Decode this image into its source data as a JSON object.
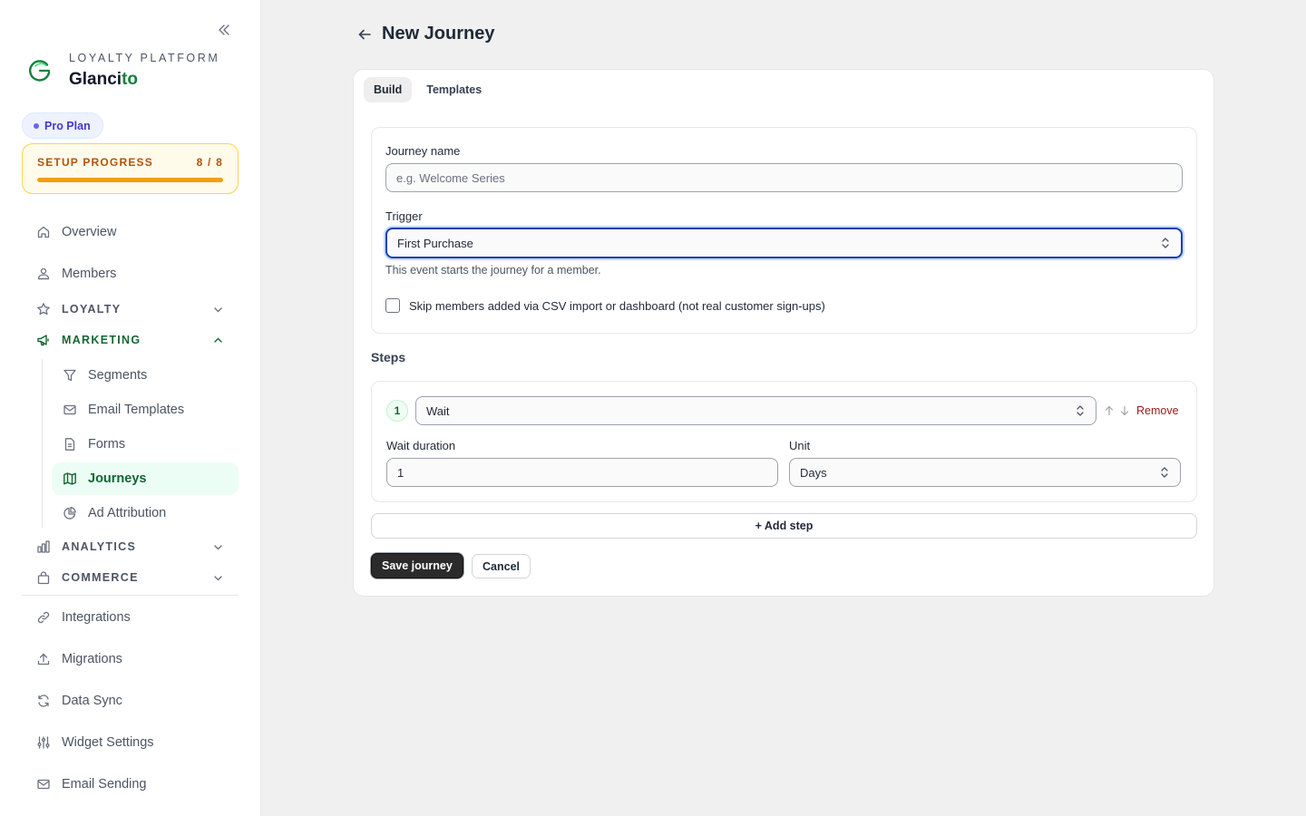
{
  "brand": {
    "eyebrow": "LOYALTY PLATFORM",
    "name_main": "Glanci",
    "name_accent": "to",
    "accent_color": "#15803d"
  },
  "plan_badge": "Pro Plan",
  "setup": {
    "label": "SETUP PROGRESS",
    "count": "8 / 8",
    "progress_fraction": 1.0
  },
  "nav": {
    "overview": "Overview",
    "members": "Members",
    "loyalty": "LOYALTY",
    "marketing": "MARKETING",
    "marketing_items": {
      "segments": "Segments",
      "email_templates": "Email Templates",
      "forms": "Forms",
      "journeys": "Journeys",
      "ad_attribution": "Ad Attribution"
    },
    "analytics": "ANALYTICS",
    "commerce": "COMMERCE",
    "integrations": "Integrations",
    "migrations": "Migrations",
    "data_sync": "Data Sync",
    "widget_settings": "Widget Settings",
    "email_sending": "Email Sending"
  },
  "page": {
    "title": "New Journey"
  },
  "tabs": {
    "build": "Build",
    "templates": "Templates"
  },
  "form": {
    "journey_name_label": "Journey name",
    "journey_name_placeholder": "e.g. Welcome Series",
    "journey_name_value": "",
    "trigger_label": "Trigger",
    "trigger_value": "First Purchase",
    "trigger_helper": "This event starts the journey for a member.",
    "skip_checkbox_label": "Skip members added via CSV import or dashboard (not real customer sign-ups)",
    "skip_checked": false
  },
  "steps": {
    "title": "Steps",
    "items": [
      {
        "number": "1",
        "type": "Wait",
        "remove_label": "Remove",
        "wait_duration_label": "Wait duration",
        "wait_duration_value": "1",
        "unit_label": "Unit",
        "unit_value": "Days"
      }
    ],
    "add_step_label": "+ Add step"
  },
  "actions": {
    "save": "Save journey",
    "cancel": "Cancel"
  },
  "colors": {
    "active_green": "#166534",
    "active_bg": "#ecfdf5",
    "focus_blue": "#1e40af",
    "remove_red": "#991b1b",
    "progress_amber": "#f59e0b"
  }
}
